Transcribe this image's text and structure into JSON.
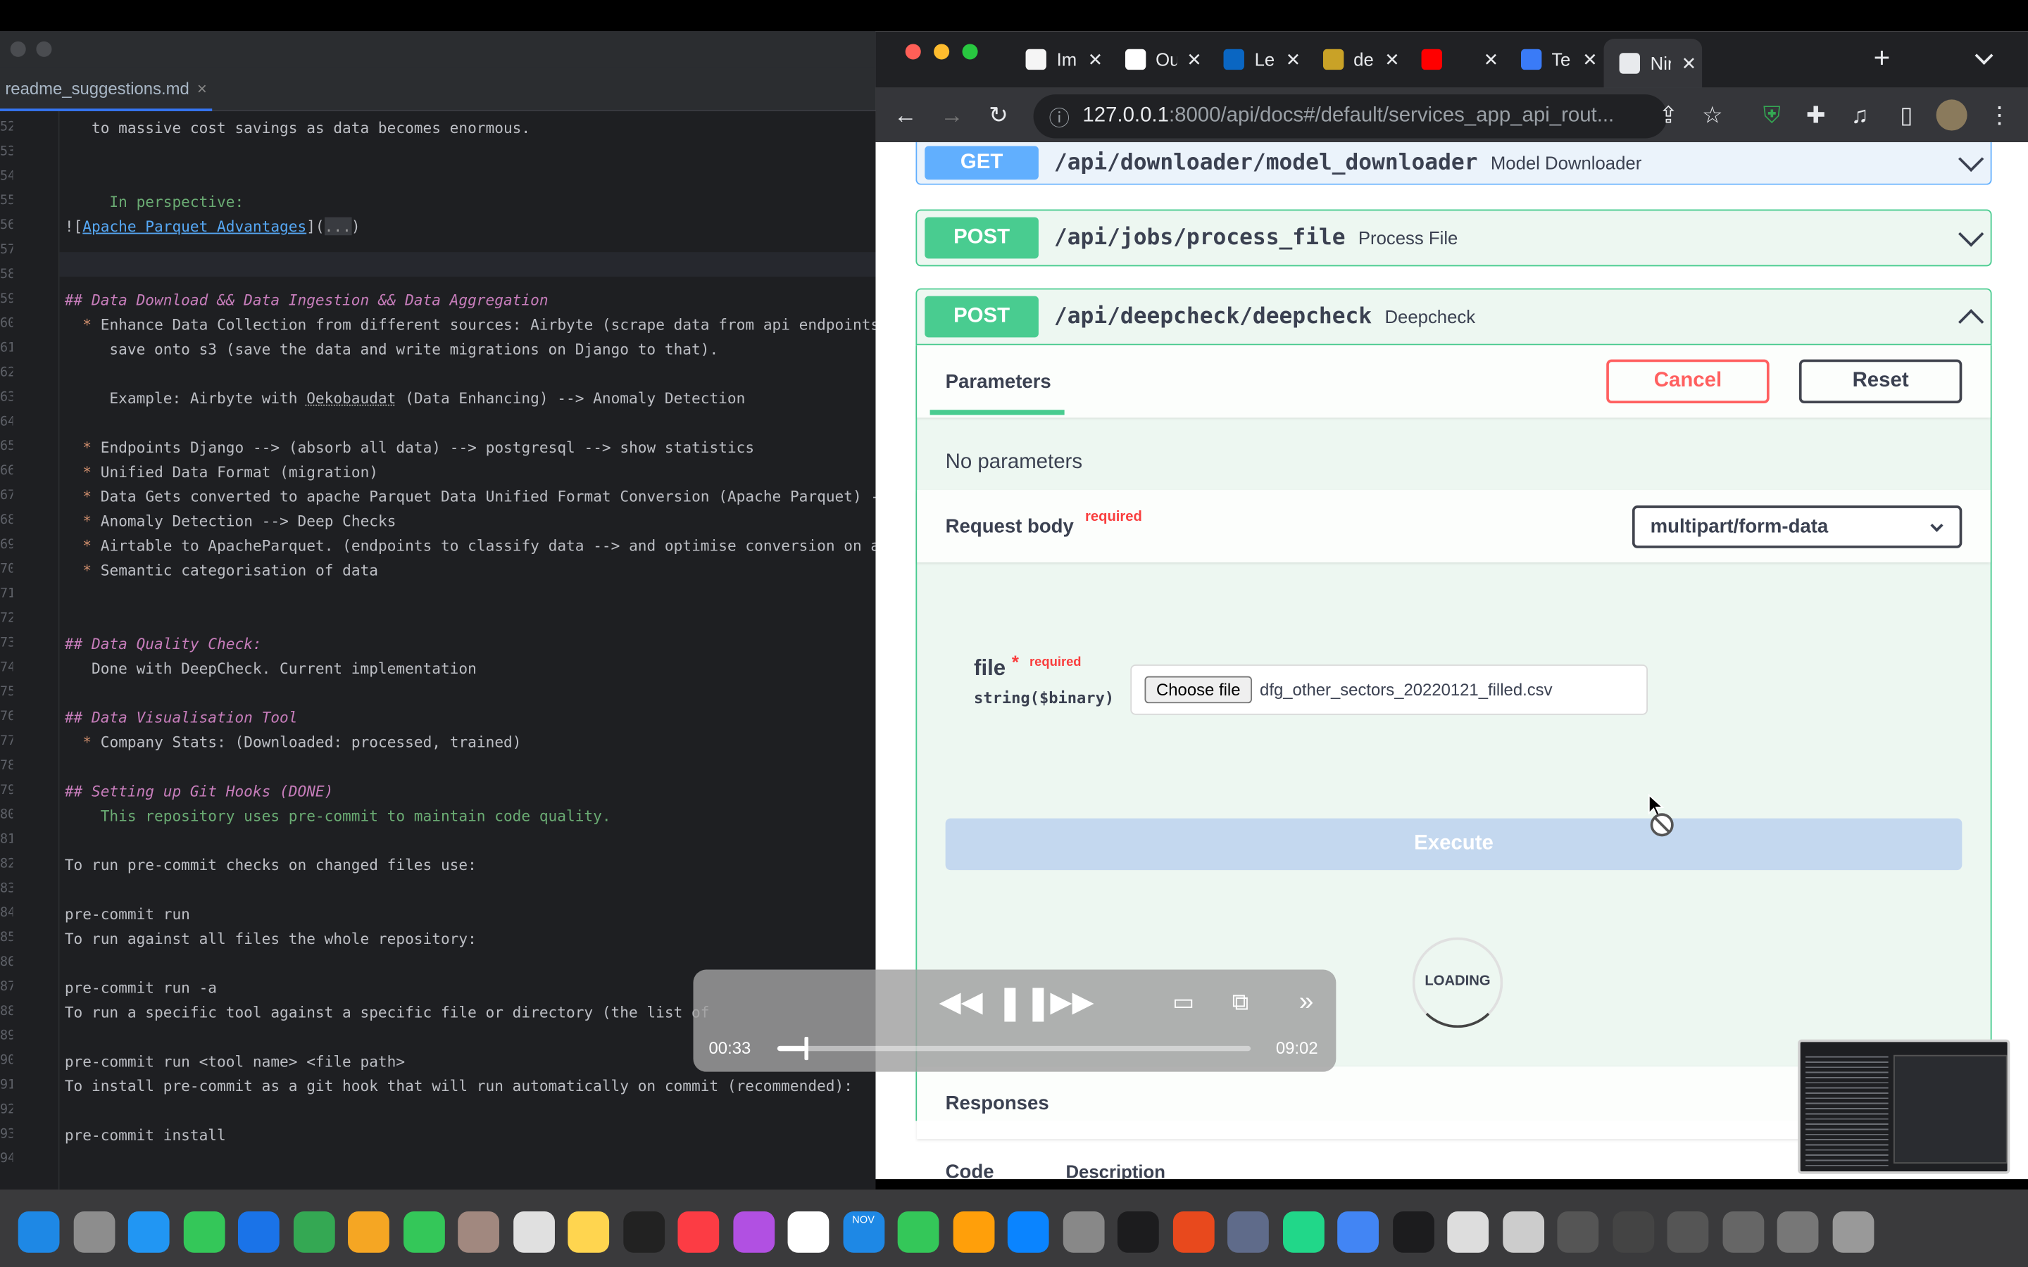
{
  "editor": {
    "tab_label": "readme_suggestions.md",
    "tab_close": "×",
    "lines": [
      {
        "n": "52",
        "t": "   to massive cost savings as data becomes enormous.",
        "c": ""
      },
      {
        "n": "53",
        "t": "",
        "c": ""
      },
      {
        "n": "54",
        "t": "",
        "c": ""
      },
      {
        "n": "55",
        "t": "     In perspective:",
        "c": "grn"
      },
      {
        "n": "56",
        "t": "",
        "c": "img"
      },
      {
        "n": "57",
        "t": "",
        "c": ""
      },
      {
        "n": "58",
        "t": "",
        "c": ""
      },
      {
        "n": "59",
        "t": "## Data Download && Data Ingestion && Data Aggregation",
        "c": "md-h"
      },
      {
        "n": "60",
        "t": "Enhance Data Collection from different sources: Airbyte (scrape data from api endpoints)",
        "c": "bul"
      },
      {
        "n": "61",
        "t": "     save onto s3 (save the data and write migrations on Django to that).",
        "c": ""
      },
      {
        "n": "62",
        "t": "",
        "c": ""
      },
      {
        "n": "63",
        "t": "",
        "c": "eg"
      },
      {
        "n": "64",
        "t": "",
        "c": ""
      },
      {
        "n": "65",
        "t": "Endpoints Django --> (absorb all data) --> postgresql --> show statistics",
        "c": "bul"
      },
      {
        "n": "66",
        "t": "Unified Data Format (migration)",
        "c": "bul"
      },
      {
        "n": "67",
        "t": "Data Gets converted to apache Parquet Data Unified Format Conversion (Apache Parquet) -->",
        "c": "bul"
      },
      {
        "n": "68",
        "t": "Anomaly Detection --> Deep Checks",
        "c": "bul"
      },
      {
        "n": "69",
        "t": "Airtable to ApacheParquet. (endpoints to classify data --> and optimise conversion on apa",
        "c": "bul"
      },
      {
        "n": "70",
        "t": "Semantic categorisation of data",
        "c": "bul"
      },
      {
        "n": "71",
        "t": "",
        "c": ""
      },
      {
        "n": "72",
        "t": "",
        "c": ""
      },
      {
        "n": "73",
        "t": "## Data Quality Check:",
        "c": "md-h"
      },
      {
        "n": "74",
        "t": "   Done with DeepCheck. Current implementation",
        "c": ""
      },
      {
        "n": "75",
        "t": "",
        "c": ""
      },
      {
        "n": "76",
        "t": "## Data Visualisation Tool",
        "c": "md-h"
      },
      {
        "n": "77",
        "t": "Company Stats: (Downloaded: processed, trained)",
        "c": "bul"
      },
      {
        "n": "78",
        "t": "",
        "c": ""
      },
      {
        "n": "79",
        "t": "## Setting up Git Hooks (DONE)",
        "c": "md-h"
      },
      {
        "n": "80",
        "t": "    This repository uses pre-commit to maintain code quality.",
        "c": "grn"
      },
      {
        "n": "81",
        "t": "",
        "c": ""
      },
      {
        "n": "82",
        "t": "To run pre-commit checks on changed files use:",
        "c": ""
      },
      {
        "n": "83",
        "t": "",
        "c": ""
      },
      {
        "n": "84",
        "t": "pre-commit run",
        "c": ""
      },
      {
        "n": "85",
        "t": "To run against all files the whole repository:",
        "c": ""
      },
      {
        "n": "86",
        "t": "",
        "c": ""
      },
      {
        "n": "87",
        "t": "pre-commit run -a",
        "c": ""
      },
      {
        "n": "88",
        "t": "To run a specific tool against a specific file or directory (the list of",
        "c": ""
      },
      {
        "n": "89",
        "t": "",
        "c": ""
      },
      {
        "n": "90",
        "t": "pre-commit run <tool name> <file path>",
        "c": ""
      },
      {
        "n": "91",
        "t": "To install pre-commit as a git hook that will run automatically on commit (recommended):",
        "c": ""
      },
      {
        "n": "92",
        "t": "",
        "c": ""
      },
      {
        "n": "93",
        "t": "pre-commit install",
        "c": ""
      },
      {
        "n": "94",
        "t": "",
        "c": ""
      }
    ],
    "img_prefix": "![",
    "img_link": "Apache Parquet Advantages",
    "img_paren_open": "](",
    "img_dots": "...",
    "img_paren_close": ")",
    "eg_prefix": "     Example: Airbyte with ",
    "eg_und": "Oekobaudat",
    "eg_suffix": " (Data Enhancing) --> Anomaly Detection",
    "bullet": "*"
  },
  "browser": {
    "tabs": [
      {
        "title": "Imp",
        "color": "#f5f5f5"
      },
      {
        "title": "Ou",
        "color": "#ffffff"
      },
      {
        "title": "Lea",
        "color": "#0a66c2"
      },
      {
        "title": "de",
        "color": "#c9a227"
      },
      {
        "title": "",
        "color": "#ff0000"
      },
      {
        "title": "Te",
        "color": "#3a7bf7"
      },
      {
        "title": "Nir",
        "color": "#e8eaed"
      }
    ],
    "tab_close": "✕",
    "new_tab": "+",
    "url_host": "127.0.0.1",
    "url_rest": ":8000/api/docs#/default/services_app_api_rout...",
    "icons": {
      "back": "←",
      "forward": "→",
      "reload": "↻",
      "info": "ⓘ",
      "share": "⇪",
      "star": "☆",
      "ext": "✚",
      "menu": "⋮"
    }
  },
  "swagger": {
    "ops": [
      {
        "method": "GET",
        "path": "/api/downloader/model_downloader",
        "summary": "Model Downloader"
      },
      {
        "method": "POST",
        "path": "/api/jobs/process_file",
        "summary": "Process File"
      },
      {
        "method": "POST",
        "path": "/api/deepcheck/deepcheck",
        "summary": "Deepcheck"
      }
    ],
    "parameters_label": "Parameters",
    "cancel_label": "Cancel",
    "reset_label": "Reset",
    "no_params": "No parameters",
    "request_body_label": "Request body",
    "required_label": "required",
    "content_type": "multipart/form-data",
    "file_label": "file",
    "file_star": "*",
    "file_type": "string($binary)",
    "choose_file_label": "Choose file",
    "file_name": "dfg_other_sectors_20220121_filled.csv",
    "execute_label": "Execute",
    "loading_label": "LOADING",
    "responses_label": "Responses",
    "code_label": "Code",
    "description_label": "Description"
  },
  "media": {
    "current": "00:33",
    "duration": "09:02",
    "progress": 0.061
  },
  "dock": {
    "calendar_month": "NOV"
  }
}
